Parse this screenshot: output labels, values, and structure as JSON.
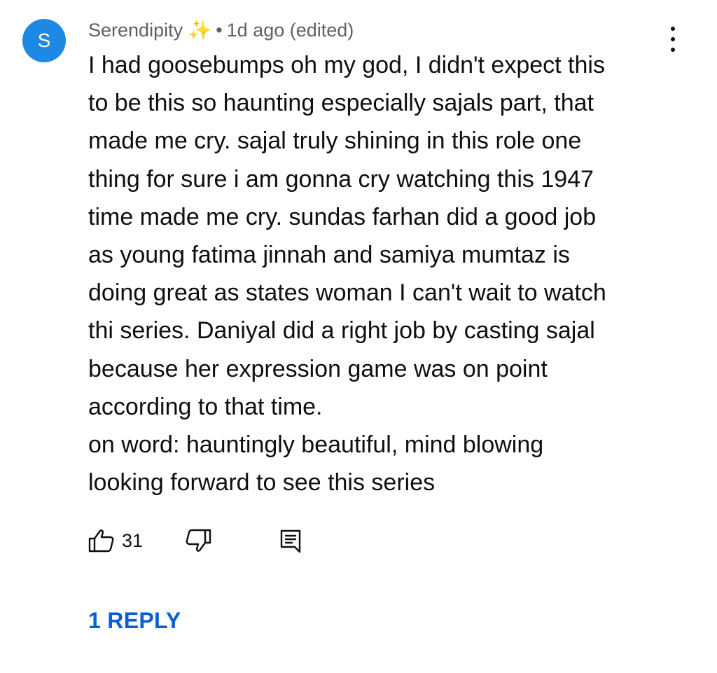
{
  "comment": {
    "avatar_letter": "S",
    "avatar_color": "#1e88e5",
    "author": "Serendipity ✨",
    "separator": "•",
    "time": "1d ago (edited)",
    "lines": [
      "I had goosebumps oh my god, I didn't expect this",
      "to be this so haunting especially sajals part, that",
      "made me cry. sajal truly shining in this role one",
      "thing for sure i am gonna cry watching this 1947",
      "time made me cry. sundas farhan did a good job",
      "as young fatima jinnah and samiya mumtaz is",
      "doing great as states woman I can't wait to watch",
      "thi series. Daniyal did a right job by casting sajal",
      "because her expression game was on point",
      "according to that time.",
      "on word: hauntingly beautiful, mind blowing",
      "looking forward to see this series"
    ],
    "like_count": "31",
    "replies_label": "1 REPLY",
    "replies_color": "#065fd4",
    "icons": {
      "like": "thumb-up-icon",
      "dislike": "thumb-down-icon",
      "reply": "reply-comment-icon",
      "menu": "more-vertical-icon"
    }
  }
}
